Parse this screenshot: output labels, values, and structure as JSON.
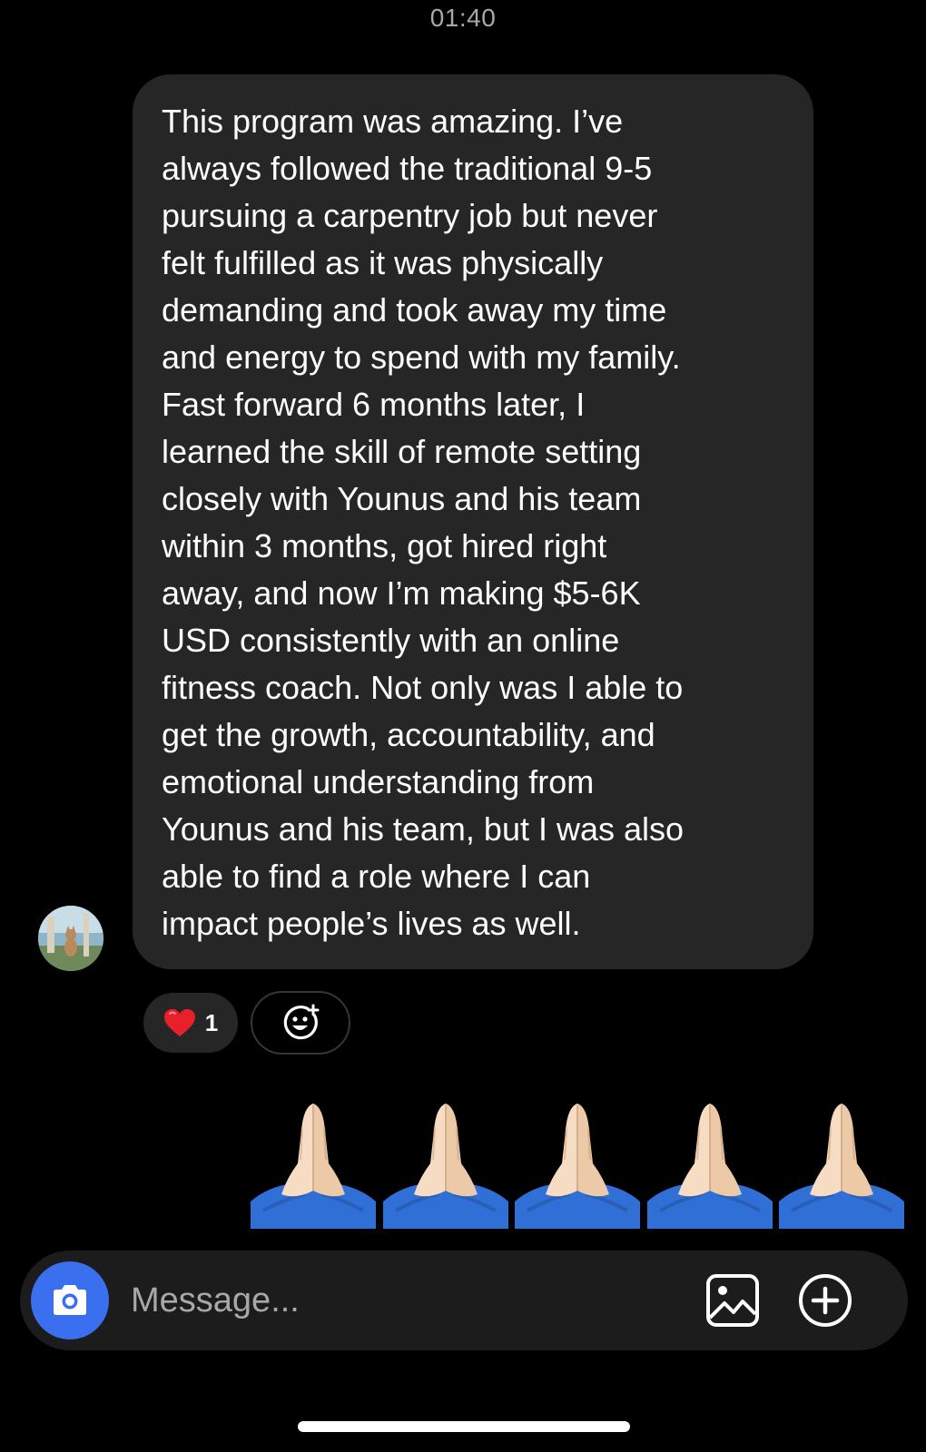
{
  "status": {
    "time": "01:40"
  },
  "message": {
    "text": "This program was amazing. I’ve\nalways followed the traditional 9-5\npursuing a carpentry job but never\nfelt fulfilled as it was physically\ndemanding and took away my time\nand energy to spend with my family.\nFast forward 6 months later, I\nlearned the skill of remote setting\nclosely with Younus and his team\nwithin 3 months, got hired right\naway, and now I’m making $5-6K\nUSD consistently with an online\nfitness coach. Not only was I able to\nget the growth, accountability, and\nemotional understanding from\nYounus and his team, but I was also\nable to find a role where I can\nimpact people’s lives as well.",
    "reaction": {
      "icon": "heart-icon",
      "count": "1"
    },
    "add_reaction_icon": "add-emoji-icon"
  },
  "reply": {
    "emoji": "🙏🙏🙏🙏🙏",
    "emoji_icon": "folded-hands-icon"
  },
  "composer": {
    "placeholder": "Message...",
    "camera_icon": "camera-icon",
    "gallery_icon": "image-icon",
    "plus_icon": "plus-circle-icon"
  },
  "colors": {
    "background": "#000000",
    "bubble": "#262626",
    "accent": "#3a6ff0",
    "muted_text": "#a8a8a8",
    "heart": "#e8202c"
  }
}
